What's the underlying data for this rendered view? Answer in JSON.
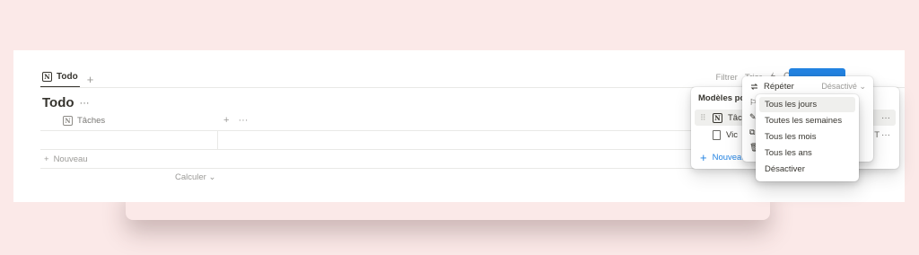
{
  "tabs": [
    {
      "label": "Todo",
      "icon": "notion-database-icon"
    }
  ],
  "toolbar": {
    "filter": "Filtrer",
    "sort": "Trier",
    "automation_icon": "lightning-icon",
    "search_icon": "search-icon"
  },
  "accent_color": "#2383e2",
  "page": {
    "title": "Todo",
    "more": "···"
  },
  "table": {
    "column_name": "Tâches",
    "new_row": "Nouveau",
    "calculate": "Calculer"
  },
  "templates_menu": {
    "title": "Modèles po",
    "items": [
      {
        "label": "Tâc",
        "icon": "notion-icon"
      },
      {
        "label": "Vic",
        "icon": "document-icon"
      }
    ],
    "add_label": "Nouveau",
    "more": "···",
    "trailing_char": "T"
  },
  "actions_menu": {
    "repeat_label": "Répéter",
    "repeat_value": "Désactivé"
  },
  "repeat_menu": {
    "options": [
      "Tous les jours",
      "Toutes les semaines",
      "Tous les mois",
      "Tous les ans",
      "Désactiver"
    ],
    "highlighted": "Tous les jours"
  }
}
